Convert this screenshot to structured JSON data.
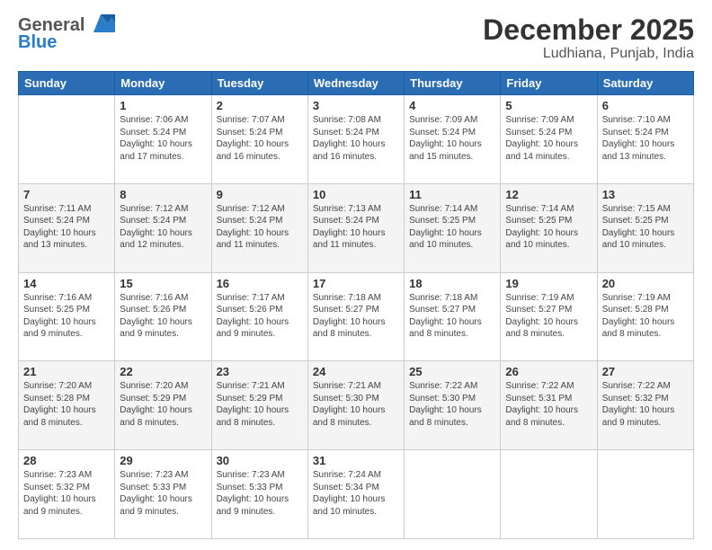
{
  "header": {
    "logo_line1": "General",
    "logo_line2": "Blue",
    "title": "December 2025",
    "subtitle": "Ludhiana, Punjab, India"
  },
  "columns": [
    "Sunday",
    "Monday",
    "Tuesday",
    "Wednesday",
    "Thursday",
    "Friday",
    "Saturday"
  ],
  "weeks": [
    [
      {
        "day": "",
        "info": ""
      },
      {
        "day": "1",
        "info": "Sunrise: 7:06 AM\nSunset: 5:24 PM\nDaylight: 10 hours\nand 17 minutes."
      },
      {
        "day": "2",
        "info": "Sunrise: 7:07 AM\nSunset: 5:24 PM\nDaylight: 10 hours\nand 16 minutes."
      },
      {
        "day": "3",
        "info": "Sunrise: 7:08 AM\nSunset: 5:24 PM\nDaylight: 10 hours\nand 16 minutes."
      },
      {
        "day": "4",
        "info": "Sunrise: 7:09 AM\nSunset: 5:24 PM\nDaylight: 10 hours\nand 15 minutes."
      },
      {
        "day": "5",
        "info": "Sunrise: 7:09 AM\nSunset: 5:24 PM\nDaylight: 10 hours\nand 14 minutes."
      },
      {
        "day": "6",
        "info": "Sunrise: 7:10 AM\nSunset: 5:24 PM\nDaylight: 10 hours\nand 13 minutes."
      }
    ],
    [
      {
        "day": "7",
        "info": "Sunrise: 7:11 AM\nSunset: 5:24 PM\nDaylight: 10 hours\nand 13 minutes."
      },
      {
        "day": "8",
        "info": "Sunrise: 7:12 AM\nSunset: 5:24 PM\nDaylight: 10 hours\nand 12 minutes."
      },
      {
        "day": "9",
        "info": "Sunrise: 7:12 AM\nSunset: 5:24 PM\nDaylight: 10 hours\nand 11 minutes."
      },
      {
        "day": "10",
        "info": "Sunrise: 7:13 AM\nSunset: 5:24 PM\nDaylight: 10 hours\nand 11 minutes."
      },
      {
        "day": "11",
        "info": "Sunrise: 7:14 AM\nSunset: 5:25 PM\nDaylight: 10 hours\nand 10 minutes."
      },
      {
        "day": "12",
        "info": "Sunrise: 7:14 AM\nSunset: 5:25 PM\nDaylight: 10 hours\nand 10 minutes."
      },
      {
        "day": "13",
        "info": "Sunrise: 7:15 AM\nSunset: 5:25 PM\nDaylight: 10 hours\nand 10 minutes."
      }
    ],
    [
      {
        "day": "14",
        "info": "Sunrise: 7:16 AM\nSunset: 5:25 PM\nDaylight: 10 hours\nand 9 minutes."
      },
      {
        "day": "15",
        "info": "Sunrise: 7:16 AM\nSunset: 5:26 PM\nDaylight: 10 hours\nand 9 minutes."
      },
      {
        "day": "16",
        "info": "Sunrise: 7:17 AM\nSunset: 5:26 PM\nDaylight: 10 hours\nand 9 minutes."
      },
      {
        "day": "17",
        "info": "Sunrise: 7:18 AM\nSunset: 5:27 PM\nDaylight: 10 hours\nand 8 minutes."
      },
      {
        "day": "18",
        "info": "Sunrise: 7:18 AM\nSunset: 5:27 PM\nDaylight: 10 hours\nand 8 minutes."
      },
      {
        "day": "19",
        "info": "Sunrise: 7:19 AM\nSunset: 5:27 PM\nDaylight: 10 hours\nand 8 minutes."
      },
      {
        "day": "20",
        "info": "Sunrise: 7:19 AM\nSunset: 5:28 PM\nDaylight: 10 hours\nand 8 minutes."
      }
    ],
    [
      {
        "day": "21",
        "info": "Sunrise: 7:20 AM\nSunset: 5:28 PM\nDaylight: 10 hours\nand 8 minutes."
      },
      {
        "day": "22",
        "info": "Sunrise: 7:20 AM\nSunset: 5:29 PM\nDaylight: 10 hours\nand 8 minutes."
      },
      {
        "day": "23",
        "info": "Sunrise: 7:21 AM\nSunset: 5:29 PM\nDaylight: 10 hours\nand 8 minutes."
      },
      {
        "day": "24",
        "info": "Sunrise: 7:21 AM\nSunset: 5:30 PM\nDaylight: 10 hours\nand 8 minutes."
      },
      {
        "day": "25",
        "info": "Sunrise: 7:22 AM\nSunset: 5:30 PM\nDaylight: 10 hours\nand 8 minutes."
      },
      {
        "day": "26",
        "info": "Sunrise: 7:22 AM\nSunset: 5:31 PM\nDaylight: 10 hours\nand 8 minutes."
      },
      {
        "day": "27",
        "info": "Sunrise: 7:22 AM\nSunset: 5:32 PM\nDaylight: 10 hours\nand 9 minutes."
      }
    ],
    [
      {
        "day": "28",
        "info": "Sunrise: 7:23 AM\nSunset: 5:32 PM\nDaylight: 10 hours\nand 9 minutes."
      },
      {
        "day": "29",
        "info": "Sunrise: 7:23 AM\nSunset: 5:33 PM\nDaylight: 10 hours\nand 9 minutes."
      },
      {
        "day": "30",
        "info": "Sunrise: 7:23 AM\nSunset: 5:33 PM\nDaylight: 10 hours\nand 9 minutes."
      },
      {
        "day": "31",
        "info": "Sunrise: 7:24 AM\nSunset: 5:34 PM\nDaylight: 10 hours\nand 10 minutes."
      },
      {
        "day": "",
        "info": ""
      },
      {
        "day": "",
        "info": ""
      },
      {
        "day": "",
        "info": ""
      }
    ]
  ]
}
